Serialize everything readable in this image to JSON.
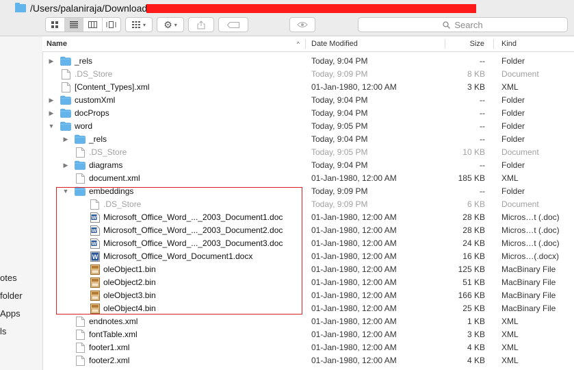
{
  "window": {
    "path": "/Users/palaniraja/Downloads"
  },
  "toolbar": {
    "search_placeholder": "Search",
    "view_modes": [
      "icon",
      "list",
      "column",
      "cover-flow"
    ]
  },
  "sidebar": {
    "items": [
      "otes",
      "folder",
      "Apps",
      "ls"
    ]
  },
  "columns": {
    "name": "Name",
    "date": "Date Modified",
    "size": "Size",
    "kind": "Kind"
  },
  "colors": {
    "folder": "#62b4ea",
    "highlight": "#d8202a",
    "redaction": "#ff1a1a"
  },
  "rows": [
    {
      "indent": 0,
      "disclosure": "closed",
      "icon": "folder",
      "name": "_rels",
      "date": "Today, 9:04 PM",
      "size": "--",
      "kind": "Folder",
      "dim": false
    },
    {
      "indent": 0,
      "disclosure": "none",
      "icon": "doc",
      "name": ".DS_Store",
      "date": "Today, 9:09 PM",
      "size": "8 KB",
      "kind": "Document",
      "dim": true
    },
    {
      "indent": 0,
      "disclosure": "none",
      "icon": "doc",
      "name": "[Content_Types].xml",
      "date": "01-Jan-1980, 12:00 AM",
      "size": "3 KB",
      "kind": "XML",
      "dim": false
    },
    {
      "indent": 0,
      "disclosure": "closed",
      "icon": "folder",
      "name": "customXml",
      "date": "Today, 9:04 PM",
      "size": "--",
      "kind": "Folder",
      "dim": false
    },
    {
      "indent": 0,
      "disclosure": "closed",
      "icon": "folder",
      "name": "docProps",
      "date": "Today, 9:04 PM",
      "size": "--",
      "kind": "Folder",
      "dim": false
    },
    {
      "indent": 0,
      "disclosure": "open",
      "icon": "folder",
      "name": "word",
      "date": "Today, 9:05 PM",
      "size": "--",
      "kind": "Folder",
      "dim": false
    },
    {
      "indent": 1,
      "disclosure": "closed",
      "icon": "folder",
      "name": "_rels",
      "date": "Today, 9:04 PM",
      "size": "--",
      "kind": "Folder",
      "dim": false
    },
    {
      "indent": 1,
      "disclosure": "none",
      "icon": "doc",
      "name": ".DS_Store",
      "date": "Today, 9:05 PM",
      "size": "10 KB",
      "kind": "Document",
      "dim": true
    },
    {
      "indent": 1,
      "disclosure": "closed",
      "icon": "folder",
      "name": "diagrams",
      "date": "Today, 9:04 PM",
      "size": "--",
      "kind": "Folder",
      "dim": false
    },
    {
      "indent": 1,
      "disclosure": "none",
      "icon": "doc",
      "name": "document.xml",
      "date": "01-Jan-1980, 12:00 AM",
      "size": "185 KB",
      "kind": "XML",
      "dim": false
    },
    {
      "indent": 1,
      "disclosure": "open",
      "icon": "folder",
      "name": "embeddings",
      "date": "Today, 9:09 PM",
      "size": "--",
      "kind": "Folder",
      "dim": false
    },
    {
      "indent": 2,
      "disclosure": "none",
      "icon": "doc",
      "name": ".DS_Store",
      "date": "Today, 9:09 PM",
      "size": "6 KB",
      "kind": "Document",
      "dim": true
    },
    {
      "indent": 2,
      "disclosure": "none",
      "icon": "word-doc",
      "name": "Microsoft_Office_Word_..._2003_Document1.doc",
      "date": "01-Jan-1980, 12:00 AM",
      "size": "28 KB",
      "kind": "Micros…t (.doc)",
      "dim": false
    },
    {
      "indent": 2,
      "disclosure": "none",
      "icon": "word-doc",
      "name": "Microsoft_Office_Word_..._2003_Document2.doc",
      "date": "01-Jan-1980, 12:00 AM",
      "size": "28 KB",
      "kind": "Micros…t (.doc)",
      "dim": false
    },
    {
      "indent": 2,
      "disclosure": "none",
      "icon": "word-doc",
      "name": "Microsoft_Office_Word_..._2003_Document3.doc",
      "date": "01-Jan-1980, 12:00 AM",
      "size": "24 KB",
      "kind": "Micros…t (.doc)",
      "dim": false
    },
    {
      "indent": 2,
      "disclosure": "none",
      "icon": "word-docx",
      "name": "Microsoft_Office_Word_Document1.docx",
      "date": "01-Jan-1980, 12:00 AM",
      "size": "16 KB",
      "kind": "Micros…(.docx)",
      "dim": false
    },
    {
      "indent": 2,
      "disclosure": "none",
      "icon": "bin",
      "name": "oleObject1.bin",
      "date": "01-Jan-1980, 12:00 AM",
      "size": "125 KB",
      "kind": "MacBinary File",
      "dim": false
    },
    {
      "indent": 2,
      "disclosure": "none",
      "icon": "bin",
      "name": "oleObject2.bin",
      "date": "01-Jan-1980, 12:00 AM",
      "size": "51 KB",
      "kind": "MacBinary File",
      "dim": false
    },
    {
      "indent": 2,
      "disclosure": "none",
      "icon": "bin",
      "name": "oleObject3.bin",
      "date": "01-Jan-1980, 12:00 AM",
      "size": "166 KB",
      "kind": "MacBinary File",
      "dim": false
    },
    {
      "indent": 2,
      "disclosure": "none",
      "icon": "bin",
      "name": "oleObject4.bin",
      "date": "01-Jan-1980, 12:00 AM",
      "size": "25 KB",
      "kind": "MacBinary File",
      "dim": false
    },
    {
      "indent": 1,
      "disclosure": "none",
      "icon": "doc",
      "name": "endnotes.xml",
      "date": "01-Jan-1980, 12:00 AM",
      "size": "1 KB",
      "kind": "XML",
      "dim": false
    },
    {
      "indent": 1,
      "disclosure": "none",
      "icon": "doc",
      "name": "fontTable.xml",
      "date": "01-Jan-1980, 12:00 AM",
      "size": "3 KB",
      "kind": "XML",
      "dim": false
    },
    {
      "indent": 1,
      "disclosure": "none",
      "icon": "doc",
      "name": "footer1.xml",
      "date": "01-Jan-1980, 12:00 AM",
      "size": "4 KB",
      "kind": "XML",
      "dim": false
    },
    {
      "indent": 1,
      "disclosure": "none",
      "icon": "doc",
      "name": "footer2.xml",
      "date": "01-Jan-1980, 12:00 AM",
      "size": "4 KB",
      "kind": "XML",
      "dim": false
    }
  ]
}
